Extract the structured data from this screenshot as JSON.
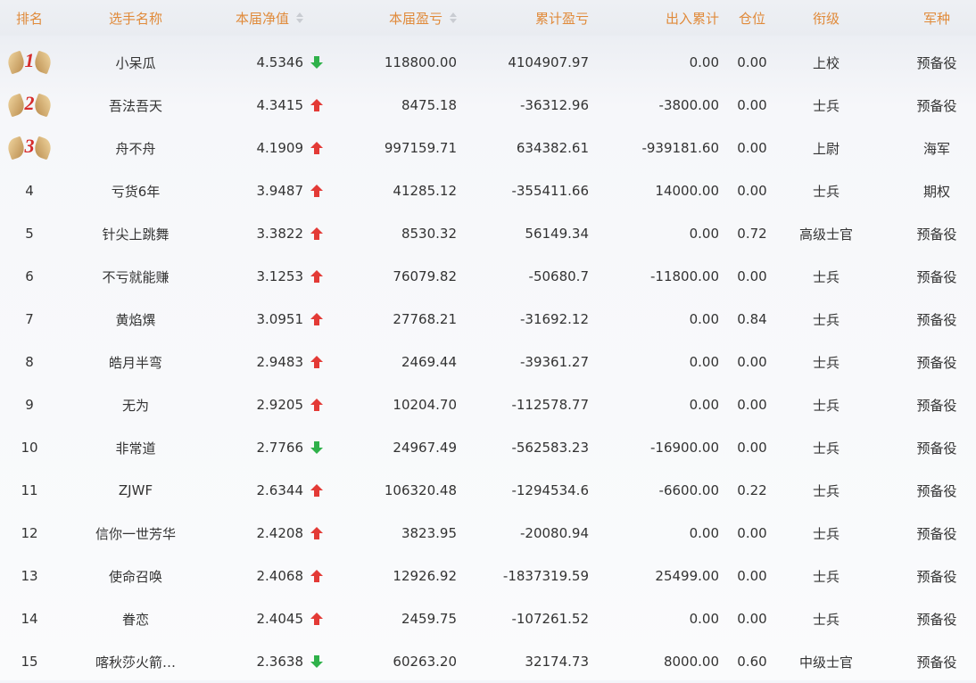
{
  "header": {
    "rank": "排名",
    "name": "选手名称",
    "nav": "本届净值",
    "profit": "本届盈亏",
    "cumulative": "累计盈亏",
    "inout": "出入累计",
    "position": "仓位",
    "title": "衔级",
    "army": "军种"
  },
  "colors": {
    "header_text": "#e08a3a",
    "up": "#e33a36",
    "down": "#2fb14a",
    "medal_number": "#d62d2d"
  },
  "rows": [
    {
      "rank": "1",
      "name": "小呆瓜",
      "nav": "4.5346",
      "trend": "down",
      "profit": "118800.00",
      "cumulative": "4104907.97",
      "inout": "0.00",
      "position": "0.00",
      "title": "上校",
      "army": "预备役"
    },
    {
      "rank": "2",
      "name": "吾法吾天",
      "nav": "4.3415",
      "trend": "up",
      "profit": "8475.18",
      "cumulative": "-36312.96",
      "inout": "-3800.00",
      "position": "0.00",
      "title": "士兵",
      "army": "预备役"
    },
    {
      "rank": "3",
      "name": "舟不舟",
      "nav": "4.1909",
      "trend": "up",
      "profit": "997159.71",
      "cumulative": "634382.61",
      "inout": "-939181.60",
      "position": "0.00",
      "title": "上尉",
      "army": "海军"
    },
    {
      "rank": "4",
      "name": "亏货6年",
      "nav": "3.9487",
      "trend": "up",
      "profit": "41285.12",
      "cumulative": "-355411.66",
      "inout": "14000.00",
      "position": "0.00",
      "title": "士兵",
      "army": "期权"
    },
    {
      "rank": "5",
      "name": "针尖上跳舞",
      "nav": "3.3822",
      "trend": "up",
      "profit": "8530.32",
      "cumulative": "56149.34",
      "inout": "0.00",
      "position": "0.72",
      "title": "高级士官",
      "army": "预备役"
    },
    {
      "rank": "6",
      "name": "不亏就能赚",
      "nav": "3.1253",
      "trend": "up",
      "profit": "76079.82",
      "cumulative": "-50680.7",
      "inout": "-11800.00",
      "position": "0.00",
      "title": "士兵",
      "army": "预备役"
    },
    {
      "rank": "7",
      "name": "黄焰熼",
      "nav": "3.0951",
      "trend": "up",
      "profit": "27768.21",
      "cumulative": "-31692.12",
      "inout": "0.00",
      "position": "0.84",
      "title": "士兵",
      "army": "预备役"
    },
    {
      "rank": "8",
      "name": "皓月半弯",
      "nav": "2.9483",
      "trend": "up",
      "profit": "2469.44",
      "cumulative": "-39361.27",
      "inout": "0.00",
      "position": "0.00",
      "title": "士兵",
      "army": "预备役"
    },
    {
      "rank": "9",
      "name": "无为",
      "nav": "2.9205",
      "trend": "up",
      "profit": "10204.70",
      "cumulative": "-112578.77",
      "inout": "0.00",
      "position": "0.00",
      "title": "士兵",
      "army": "预备役"
    },
    {
      "rank": "10",
      "name": "非常道",
      "nav": "2.7766",
      "trend": "down",
      "profit": "24967.49",
      "cumulative": "-562583.23",
      "inout": "-16900.00",
      "position": "0.00",
      "title": "士兵",
      "army": "预备役"
    },
    {
      "rank": "11",
      "name": "ZJWF",
      "nav": "2.6344",
      "trend": "up",
      "profit": "106320.48",
      "cumulative": "-1294534.6",
      "inout": "-6600.00",
      "position": "0.22",
      "title": "士兵",
      "army": "预备役"
    },
    {
      "rank": "12",
      "name": "信你一世芳华",
      "nav": "2.4208",
      "trend": "up",
      "profit": "3823.95",
      "cumulative": "-20080.94",
      "inout": "0.00",
      "position": "0.00",
      "title": "士兵",
      "army": "预备役"
    },
    {
      "rank": "13",
      "name": "使命召唤",
      "nav": "2.4068",
      "trend": "up",
      "profit": "12926.92",
      "cumulative": "-1837319.59",
      "inout": "25499.00",
      "position": "0.00",
      "title": "士兵",
      "army": "预备役"
    },
    {
      "rank": "14",
      "name": "眷恋",
      "nav": "2.4045",
      "trend": "up",
      "profit": "2459.75",
      "cumulative": "-107261.52",
      "inout": "0.00",
      "position": "0.00",
      "title": "士兵",
      "army": "预备役"
    },
    {
      "rank": "15",
      "name": "喀秋莎火箭…",
      "nav": "2.3638",
      "trend": "down",
      "profit": "60263.20",
      "cumulative": "32174.73",
      "inout": "8000.00",
      "position": "0.60",
      "title": "中级士官",
      "army": "预备役"
    }
  ]
}
